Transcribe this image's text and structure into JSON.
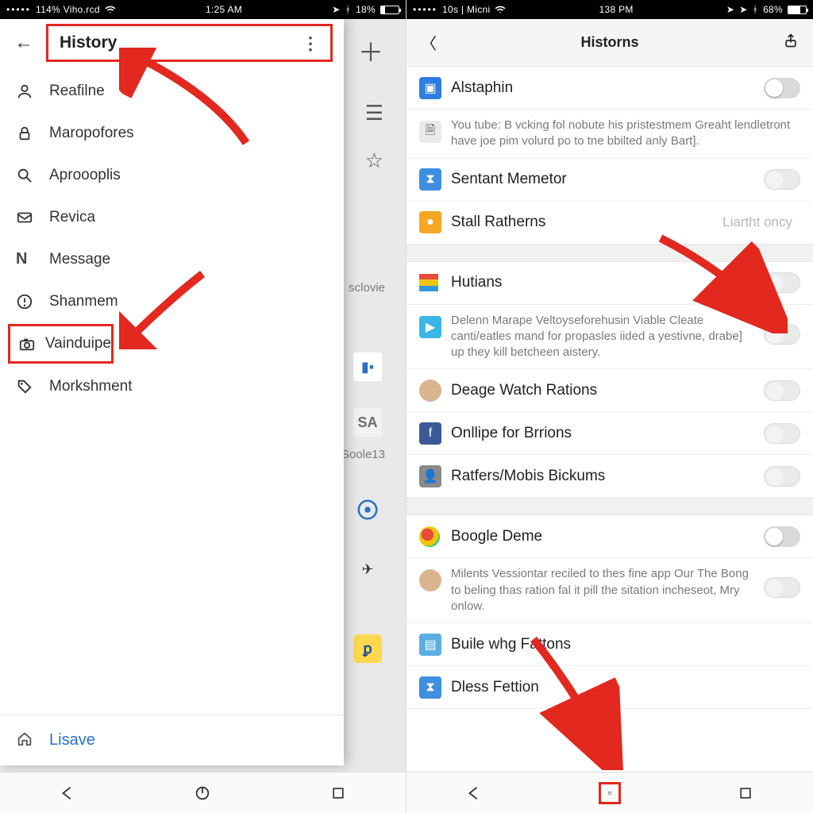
{
  "left": {
    "status": {
      "carrier": "114% Viho.rcd",
      "time": "1:25 AM",
      "battery_pct": "18%"
    },
    "header": {
      "title": "History"
    },
    "menu": [
      {
        "icon": "person-icon",
        "label": "Reafilne"
      },
      {
        "icon": "lock-icon",
        "label": "Maropofores"
      },
      {
        "icon": "search-icon",
        "label": "Aproooplis"
      },
      {
        "icon": "mail-icon",
        "label": "Revica"
      },
      {
        "icon": "letter-n-icon",
        "label": "Message"
      },
      {
        "icon": "alert-icon",
        "label": "Shanmem"
      },
      {
        "icon": "camera-icon",
        "label": "Vainduipe"
      },
      {
        "icon": "tag-icon",
        "label": "Morkshment"
      }
    ],
    "footer": {
      "label": "Lisave"
    },
    "bg": {
      "label_sclovie": "sclovie",
      "label_soole": "Soole13",
      "sa_label": "SA"
    }
  },
  "right": {
    "status": {
      "carrier": "10s | Micni",
      "time": "138 PM",
      "battery_pct": "68%"
    },
    "header": {
      "title": "Historns"
    },
    "rows": {
      "alstaphin": "Alstaphin",
      "youtube_blurb": "You tube: B vcking fol nobute his pristestmem Greaht lendletront have joe pim volurd po to tne bbilted anly Bart].",
      "sentant": "Sentant Memetor",
      "stall": "Stall Ratherns",
      "stall_side": "Liartht oncy",
      "hutians": "Hutians",
      "delenn_blurb": "Delenn Marape Veltoyseforehusin Viable Cleate canti/eatles mand for propasles iided a yestivne, drabe] up they kill betcheen aistery.",
      "deage": "Deage Watch Rations",
      "onllipe": "Onllipe for Brrions",
      "ratfers": "Ratfers/Mobis Bickums",
      "boogle": "Boogle Deme",
      "milents_blurb": "Milents Vessiontar reciled to thes fine app Our The Bong to beling thas ration fal it pill the sitation incheseot, Mry onlow.",
      "buile": "Buile whg Fattons",
      "dless": "Dless Fettion"
    }
  },
  "nav": {
    "back": "◁",
    "home": "⏻",
    "recent": "▢"
  },
  "colors": {
    "accent_red": "#E2281F"
  }
}
